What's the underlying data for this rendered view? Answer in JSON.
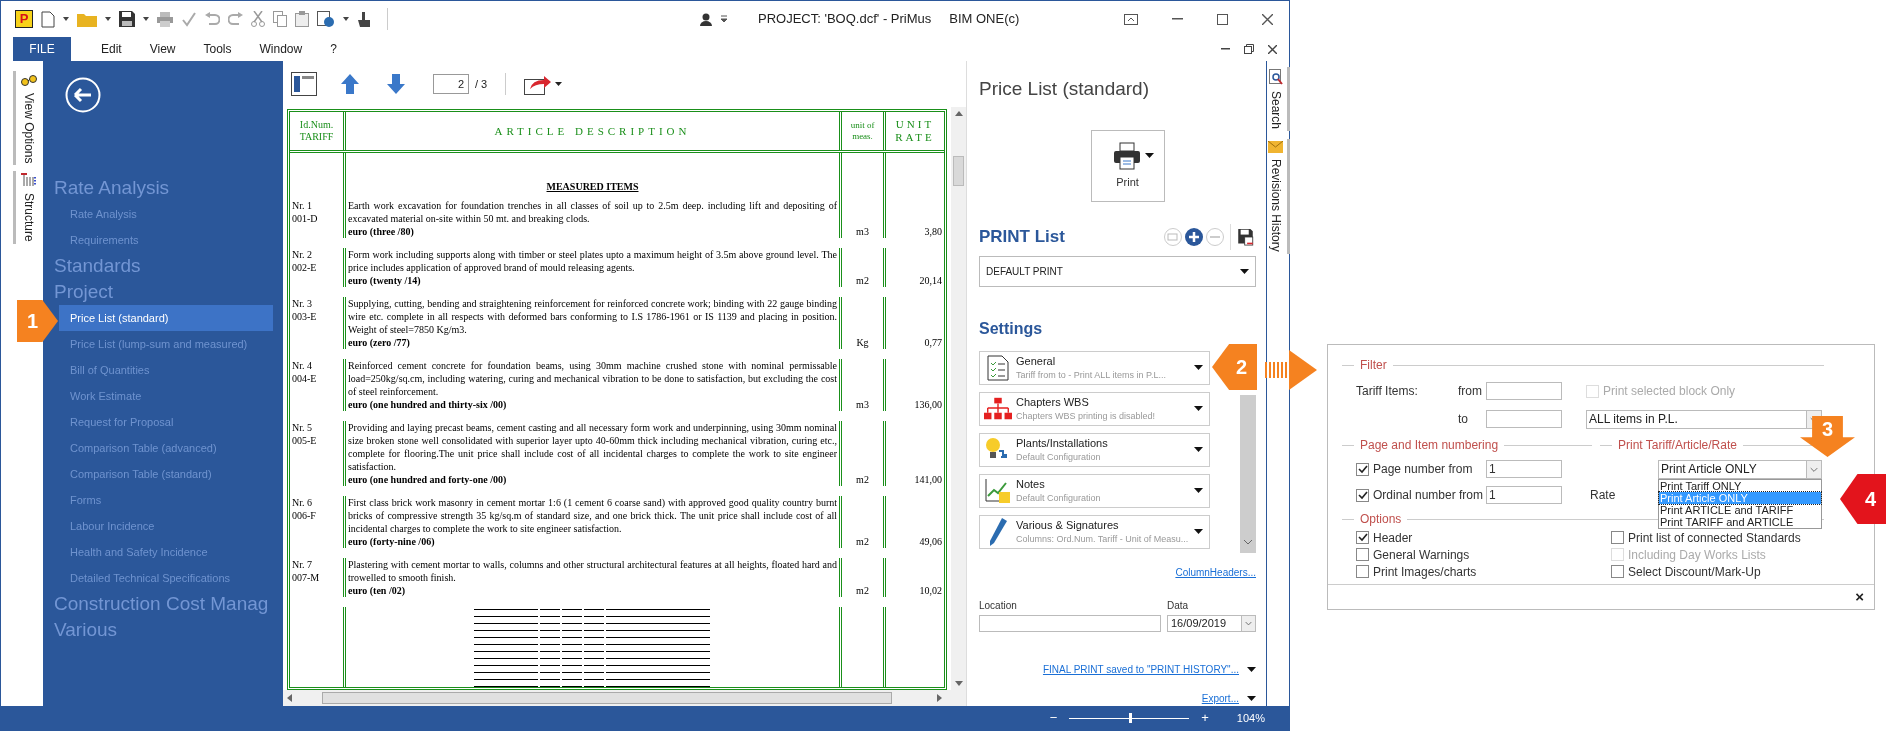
{
  "title_bar": {
    "logo": "P",
    "title": "PROJECT: 'BOQ.dcf' - PriMus",
    "app": "BIM ONE(c)"
  },
  "menu": [
    {
      "label": "FILE",
      "kind": "file"
    },
    {
      "label": "Edit",
      "kind": "menu"
    },
    {
      "label": "View",
      "kind": "menu"
    },
    {
      "label": "Tools",
      "kind": "menu"
    },
    {
      "label": "Window",
      "kind": "menu"
    },
    {
      "label": "?",
      "kind": "menu"
    }
  ],
  "left_tabs": [
    {
      "label": "View Options",
      "kind": "options"
    },
    {
      "label": "Structure",
      "kind": "structure"
    }
  ],
  "nav": [
    {
      "title": "Rate Analysis",
      "items": [
        {
          "label": "Rate Analysis",
          "selected": false
        },
        {
          "label": "Requirements",
          "selected": false
        }
      ]
    },
    {
      "title": "Standards"
    },
    {
      "title": "Project",
      "items": [
        {
          "label": "Price List (standard)",
          "selected": true
        },
        {
          "label": "Price List (lump-sum and measured)",
          "selected": false
        },
        {
          "label": "Bill of Quantities",
          "selected": false
        },
        {
          "label": "Work Estimate",
          "selected": false
        },
        {
          "label": "Request for Proposal",
          "selected": false
        },
        {
          "label": "Comparison Table (advanced)",
          "selected": false
        },
        {
          "label": "Comparison Table (standard)",
          "selected": false
        },
        {
          "label": "Forms",
          "selected": false
        },
        {
          "label": "Labour Incidence",
          "selected": false
        },
        {
          "label": "Health and Safety Incidence",
          "selected": false
        },
        {
          "label": "Detailed Technical Specifications",
          "selected": false
        }
      ]
    },
    {
      "title": "Construction Cost Manag"
    },
    {
      "title": "Various"
    }
  ],
  "document": {
    "page": "2",
    "page_total": "/ 3",
    "columns": [
      "Id.Num. TARIFF",
      "ARTICLE DESCRIPTION",
      "unit of meas.",
      "UNIT RATE"
    ],
    "section_title": "MEASURED ITEMS",
    "rows": [
      {
        "num": "Nr. 1",
        "code": "001-D",
        "description": "Earth work excavation for foundation trenches in all classes of soil up to 2.5m deep. including lift and depositing of excavated material on-site within 50 mt. and breaking clods.",
        "price_words": "euro (three /80)",
        "unit": "m3",
        "rate": "3,80"
      },
      {
        "num": "Nr. 2",
        "code": "002-E",
        "description": "Form work including supports along with timber or steel plates upto a maximum height of 3.5m above ground level. The price includes application of approved brand of mould releasing agents.",
        "price_words": "euro (twenty /14)",
        "unit": "m2",
        "rate": "20,14"
      },
      {
        "num": "Nr. 3",
        "code": "003-E",
        "description": "Supplying, cutting, bending and straightening reinforcement for reinforced concrete work; binding with 22 gauge binding wire etc. complete in all respects with deformed bars conforming to I.S 1786-1961 or IS 1139 and placing in position. Weight of steel=7850 Kg/m3.",
        "price_words": "euro (zero /77)",
        "unit": "Kg",
        "rate": "0,77"
      },
      {
        "num": "Nr. 4",
        "code": "004-E",
        "description": "Reinforced cement concrete for foundation beams, using 30mm machine crushed stone with nominal permissable load=250kg/sq.cm, including watering, curing and mechanical vibration to be done to satisfaction, but excluding the cost of steel reinforcement.",
        "price_words": "euro (one hundred and thirty-six /00)",
        "unit": "m3",
        "rate": "136,00"
      },
      {
        "num": "Nr. 5",
        "code": "005-E",
        "description": "Providing and laying precast beams, cement casting and all necessary form work and underpinning, using 30mm nominal size broken stone well consolidated with superior layer upto 40-60mm thick including mechanical vibration, curing etc., complete for flooring.The unit price shall include cost of all incidental charges to complete the work to site engineer satisfaction.",
        "price_words": "euro (one hundred and forty-one /00)",
        "unit": "m2",
        "rate": "141,00"
      },
      {
        "num": "Nr. 6",
        "code": "006-F",
        "description": "First class brick work masonry in cement mortar 1:6 (1 cement 6 coarse sand) with approved good quality country burnt bricks of compressive strength 35 kg/sq.m of standard size, and one brick thick. The unit price shall include cost of all incidental charges to complete the work to site engineer satisfaction.",
        "price_words": "euro (forty-nine /06)",
        "unit": "m2",
        "rate": "49,06"
      },
      {
        "num": "Nr. 7",
        "code": "007-M",
        "description": "Plastering with cement mortar to walls, columns and other structural architectural features at all heights, floated hard and trowelled to smooth finish.",
        "price_words": "euro (ten /02)",
        "unit": "m2",
        "rate": "10,02"
      }
    ]
  },
  "panel": {
    "title": "Price List (standard)",
    "print_button": "Print",
    "print_list_title": "PRINT List",
    "print_list_value": "DEFAULT PRINT",
    "settings_title": "Settings",
    "settings": [
      {
        "kind": "document",
        "title": "General",
        "subtitle": "Tariff from  to - Print ALL items in P.L..."
      },
      {
        "kind": "hierarchy",
        "title": "Chapters WBS",
        "subtitle": "Chapters WBS printing is disabled!"
      },
      {
        "kind": "bulb",
        "title": "Plants/Installations",
        "subtitle": "Default Configuration"
      },
      {
        "kind": "chart",
        "title": "Notes",
        "subtitle": "Default Configuration"
      },
      {
        "kind": "pen",
        "title": "Various & Signatures",
        "subtitle": "Columns: Ord.Num. Tariff - Unit of Measu..."
      }
    ],
    "column_headers_link": "ColumnHeaders...",
    "location_label": "Location",
    "date_label": "Data",
    "date_value": "16/09/2019",
    "final_print_link": "FINAL PRINT saved to \"PRINT HISTORY\"...",
    "export_link": "Export..."
  },
  "right_tabs": [
    {
      "label": "Search",
      "kind": "search"
    },
    {
      "label": "Revisions History",
      "kind": "mail"
    }
  ],
  "status_bar": {
    "zoom_out": "−",
    "zoom_in": "+",
    "zoom": "104%",
    "level": 0.5
  },
  "filter_dialog": {
    "filter_label": "Filter",
    "tariff_label": "Tariff Items:",
    "from_label": "from",
    "to_label": "to",
    "block_only": {
      "label": "Print selected block Only",
      "checked": false,
      "disabled": true
    },
    "items_select": "ALL items in P.L.",
    "numbering_label": "Page and Item numbering",
    "page_number": {
      "label": "Page number from",
      "checked": true,
      "value": "1"
    },
    "ordinal_number": {
      "label": "Ordinal number from",
      "checked": true,
      "value": "1"
    },
    "print_mode_label": "Print Tariff/Article/Rate",
    "print_mode_select": "Print Article ONLY",
    "rate_label": "Rate",
    "print_mode_options": [
      {
        "label": "Print Tariff ONLY",
        "selected": false
      },
      {
        "label": "Print Article ONLY",
        "selected": true
      },
      {
        "label": "Print ARTICLE and TARIFF",
        "selected": false
      },
      {
        "label": "Print TARIFF and ARTICLE",
        "selected": false
      }
    ],
    "options_label": "Options",
    "options": [
      {
        "label": "Header",
        "checked": true,
        "disabled": false
      },
      {
        "label": "Print list of connected Standards",
        "checked": false,
        "disabled": false
      },
      {
        "label": "General Warnings",
        "checked": false,
        "disabled": false
      },
      {
        "label": "Including Day Works Lists",
        "checked": false,
        "disabled": true
      },
      {
        "label": "Print Images/charts",
        "checked": false,
        "disabled": false
      },
      {
        "label": "Select Discount/Mark-Up",
        "checked": false,
        "disabled": false
      }
    ],
    "close": "×"
  },
  "callouts": [
    {
      "label": "1",
      "kind": "right",
      "color": "#f58220"
    },
    {
      "label": "2",
      "kind": "left",
      "color": "#f58220"
    },
    {
      "label": "3",
      "kind": "down",
      "color": "#f58220"
    },
    {
      "label": "4",
      "kind": "left",
      "color": "#e3141c"
    }
  ]
}
